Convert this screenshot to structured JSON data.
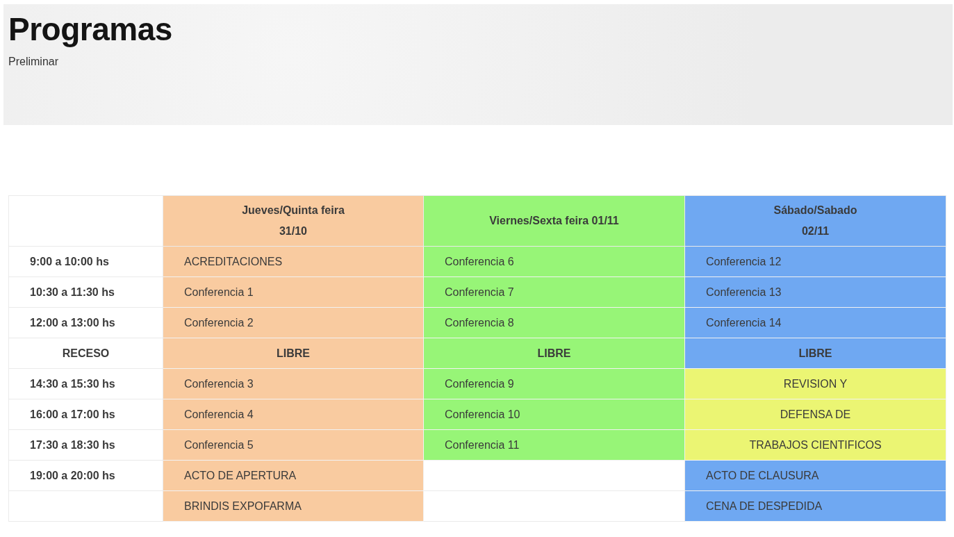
{
  "banner": {
    "title": "Programas",
    "subtitle": "Preliminar"
  },
  "table": {
    "columns": [
      {
        "lines": [
          "Jueves/Quinta feira",
          "31/10"
        ],
        "color": "#f9cba0"
      },
      {
        "lines": [
          "Viernes/Sexta feira 01/11"
        ],
        "color": "#97f577"
      },
      {
        "lines": [
          "Sábado/Sabado",
          "02/11"
        ],
        "color": "#6fa8f2"
      }
    ],
    "rows": [
      {
        "time": {
          "kind": "time",
          "text": "9:00 a 10:00 hs"
        },
        "cells": [
          {
            "kind": "item",
            "text": "ACREDITACIONES",
            "color": "#f9cba0"
          },
          {
            "kind": "item",
            "text": "Conferencia 6",
            "color": "#97f577"
          },
          {
            "kind": "item",
            "text": "Conferencia 12",
            "color": "#6fa8f2"
          }
        ]
      },
      {
        "time": {
          "kind": "time",
          "text": "10:30 a 11:30 hs"
        },
        "cells": [
          {
            "kind": "item",
            "text": "Conferencia 1",
            "color": "#f9cba0"
          },
          {
            "kind": "item",
            "text": "Conferencia 7",
            "color": "#97f577"
          },
          {
            "kind": "item",
            "text": "Conferencia 13",
            "color": "#6fa8f2"
          }
        ]
      },
      {
        "time": {
          "kind": "time",
          "text": "12:00 a 13:00 hs"
        },
        "cells": [
          {
            "kind": "item",
            "text": "Conferencia 2",
            "color": "#f9cba0"
          },
          {
            "kind": "item",
            "text": "Conferencia 8",
            "color": "#97f577"
          },
          {
            "kind": "item",
            "text": "Conferencia 14",
            "color": "#6fa8f2"
          }
        ]
      },
      {
        "time": {
          "kind": "break",
          "text": "RECESO"
        },
        "cells": [
          {
            "kind": "break",
            "text": "LIBRE",
            "color": "#f9cba0"
          },
          {
            "kind": "break",
            "text": "LIBRE",
            "color": "#97f577"
          },
          {
            "kind": "break",
            "text": "LIBRE",
            "color": "#6fa8f2"
          }
        ]
      },
      {
        "time": {
          "kind": "time",
          "text": "14:30 a 15:30 hs"
        },
        "cells": [
          {
            "kind": "item",
            "text": "Conferencia 3",
            "color": "#f9cba0"
          },
          {
            "kind": "item",
            "text": "Conferencia 9",
            "color": "#97f577"
          },
          {
            "kind": "center",
            "text": "REVISION Y",
            "color": "#ebf573"
          }
        ]
      },
      {
        "time": {
          "kind": "time",
          "text": "16:00 a 17:00 hs"
        },
        "cells": [
          {
            "kind": "item",
            "text": "Conferencia 4",
            "color": "#f9cba0"
          },
          {
            "kind": "item",
            "text": "Conferencia 10",
            "color": "#97f577"
          },
          {
            "kind": "center",
            "text": "DEFENSA DE",
            "color": "#ebf573"
          }
        ]
      },
      {
        "time": {
          "kind": "time",
          "text": "17:30 a 18:30 hs"
        },
        "cells": [
          {
            "kind": "item",
            "text": "Conferencia 5",
            "color": "#f9cba0"
          },
          {
            "kind": "item",
            "text": "Conferencia 11",
            "color": "#97f577"
          },
          {
            "kind": "center",
            "text": "TRABAJOS CIENTIFICOS",
            "color": "#ebf573"
          }
        ]
      },
      {
        "time": {
          "kind": "time",
          "text": "19:00 a 20:00 hs"
        },
        "cells": [
          {
            "kind": "item",
            "text": "ACTO DE APERTURA",
            "color": "#f9cba0"
          },
          {
            "kind": "empty"
          },
          {
            "kind": "item",
            "text": "ACTO DE CLAUSURA",
            "color": "#6fa8f2"
          }
        ]
      },
      {
        "time": {
          "kind": "empty"
        },
        "cells": [
          {
            "kind": "item",
            "text": "BRINDIS EXPOFARMA",
            "color": "#f9cba0"
          },
          {
            "kind": "empty"
          },
          {
            "kind": "item",
            "text": "CENA DE DESPEDIDA",
            "color": "#6fa8f2"
          }
        ]
      }
    ]
  }
}
